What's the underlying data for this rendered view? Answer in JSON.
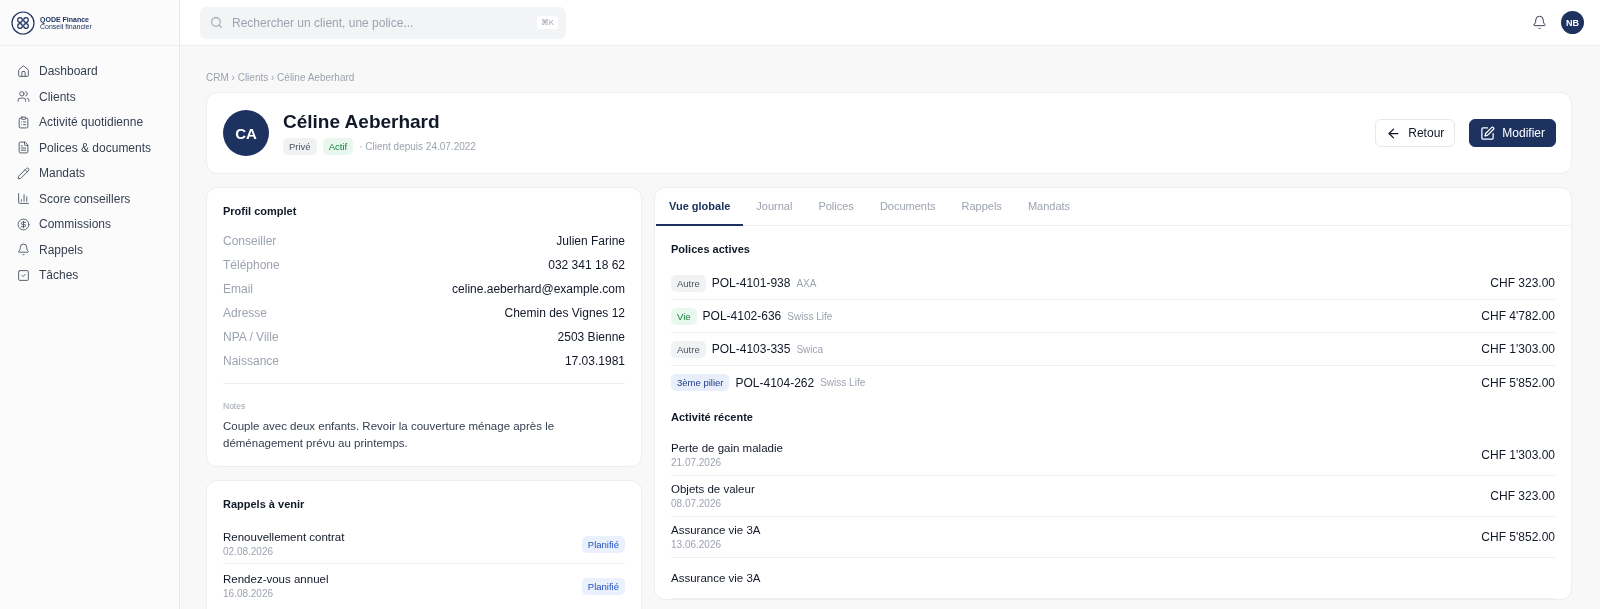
{
  "brand": {
    "name": "QODE Finance",
    "tagline": "Conseil financier"
  },
  "sidebar": {
    "items": [
      {
        "label": "Dashboard",
        "kind": "home",
        "selected": false
      },
      {
        "label": "Clients",
        "kind": "users",
        "selected": false
      },
      {
        "label": "Activité quotidienne",
        "kind": "clipboard",
        "selected": false
      },
      {
        "label": "Polices & documents",
        "kind": "file",
        "selected": false
      },
      {
        "label": "Mandats",
        "kind": "pencil",
        "selected": false
      },
      {
        "label": "Score conseillers",
        "kind": "chart",
        "selected": false
      },
      {
        "label": "Commissions",
        "kind": "dollar",
        "selected": false
      },
      {
        "label": "Rappels",
        "kind": "bell",
        "selected": false
      },
      {
        "label": "Tâches",
        "kind": "check",
        "selected": false
      }
    ]
  },
  "topbar": {
    "search": {
      "placeholder": "Rechercher un client, une police...",
      "shortcut": "⌘K"
    },
    "user_initials": "NB"
  },
  "breadcrumb": "CRM › Clients › Céline Aeberhard",
  "client": {
    "initials": "CA",
    "name": "Céline Aeberhard",
    "tags": [
      {
        "label": "Privé",
        "kind": "neutral"
      },
      {
        "label": "Actif",
        "kind": "green"
      }
    ],
    "since": "· Client depuis 24.07.2022",
    "buttons": [
      {
        "label": "Retour",
        "kind": "back"
      },
      {
        "label": "Modifier",
        "kind": "edit"
      }
    ]
  },
  "profile": {
    "title": "Profil complet",
    "fields": [
      {
        "label": "Conseiller",
        "value": "Julien Farine"
      },
      {
        "label": "Téléphone",
        "value": "032 341 18 62"
      },
      {
        "label": "Email",
        "value": "celine.aeberhard@example.com"
      },
      {
        "label": "Adresse",
        "value": "Chemin des Vignes 12"
      },
      {
        "label": "NPA / Ville",
        "value": "2503 Bienne"
      },
      {
        "label": "Naissance",
        "value": "17.03.1981"
      }
    ],
    "notes_label": "Notes",
    "notes": "Couple avec deux enfants. Revoir la couverture ménage après le déménagement prévu au printemps."
  },
  "reminders": {
    "title": "Rappels à venir",
    "items": [
      {
        "title": "Renouvellement contrat",
        "date": "02.08.2026",
        "status": "Planifié"
      },
      {
        "title": "Rendez-vous annuel",
        "date": "16.08.2026",
        "status": "Planifié"
      }
    ]
  },
  "tabs": [
    {
      "label": "Vue globale",
      "selected": true
    },
    {
      "label": "Journal",
      "selected": false
    },
    {
      "label": "Polices",
      "selected": false
    },
    {
      "label": "Documents",
      "selected": false
    },
    {
      "label": "Rappels",
      "selected": false
    },
    {
      "label": "Mandats",
      "selected": false
    }
  ],
  "policies": {
    "title": "Polices actives",
    "rows": [
      {
        "tag": "Autre",
        "kind": "neutral",
        "number": "POL-4101-938",
        "insurer": "AXA",
        "amount": "CHF 323.00"
      },
      {
        "tag": "Vie",
        "kind": "green",
        "number": "POL-4102-636",
        "insurer": "Swiss Life",
        "amount": "CHF 4'782.00"
      },
      {
        "tag": "Autre",
        "kind": "neutral",
        "number": "POL-4103-335",
        "insurer": "Swica",
        "amount": "CHF 1'303.00"
      },
      {
        "tag": "3ème pilier",
        "kind": "blue",
        "number": "POL-4104-262",
        "insurer": "Swiss Life",
        "amount": "CHF 5'852.00"
      }
    ]
  },
  "activity": {
    "title": "Activité récente",
    "rows": [
      {
        "title": "Perte de gain maladie",
        "date": "21.07.2026",
        "amount": "CHF 1'303.00"
      },
      {
        "title": "Objets de valeur",
        "date": "08.07.2026",
        "amount": "CHF 323.00"
      },
      {
        "title": "Assurance vie 3A",
        "date": "13.06.2026",
        "amount": "CHF 5'852.00"
      },
      {
        "title": "Assurance vie 3A"
      }
    ]
  }
}
